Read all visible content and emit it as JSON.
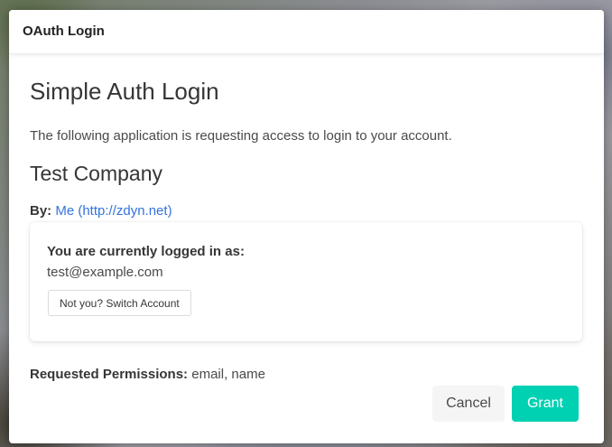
{
  "modal": {
    "header_title": "OAuth Login",
    "page_title": "Simple Auth Login",
    "intro_text": "The following application is requesting access to login to your account."
  },
  "application": {
    "name": "Test Company",
    "by_label": "By:",
    "by_link_text": "Me (http://zdyn.net)"
  },
  "account": {
    "logged_in_label": "You are currently logged in as:",
    "email": "test@example.com",
    "switch_button_label": "Not you? Switch Account"
  },
  "permissions": {
    "label": "Requested Permissions:",
    "value": "email, name"
  },
  "actions": {
    "cancel_label": "Cancel",
    "grant_label": "Grant"
  },
  "colors": {
    "primary": "#00d1b2",
    "link": "#3273dc"
  }
}
